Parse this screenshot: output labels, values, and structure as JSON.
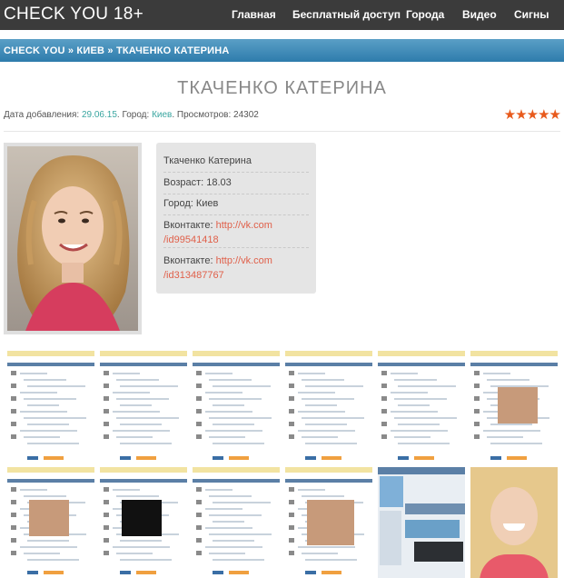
{
  "header": {
    "logo": "CHECK YOU 18+",
    "nav": [
      "Главная",
      "Бесплатный доступ",
      "Города",
      "Видео",
      "Сигны"
    ]
  },
  "breadcrumb": "CHECK YOU » КИЕВ » ТКАЧЕНКО КАТЕРИНА",
  "profile": {
    "title": "ТКАЧЕНКО КАТЕРИНА",
    "meta_added_label": "Дата добавления:",
    "meta_added_value": "29.06.15",
    "meta_city_label": "Город:",
    "meta_city_value": "Киев",
    "meta_views_label": "Просмотров:",
    "meta_views_value": "24302",
    "rating_stars": 5,
    "name": "Ткаченко Катерина",
    "age": "Возраст: 18.03",
    "city": "Город: Киев",
    "vk_label": "Вконтакте:",
    "vk1_a": "http://vk.com",
    "vk1_b": "/id99541418",
    "vk2_a": "http://vk.com",
    "vk2_b": "/id313487767"
  },
  "colors": {
    "topbar": "#3b3b3b",
    "breadcrumb": "#3b85b4",
    "accent_link": "#3aa6a0",
    "vk_link": "#e0604a",
    "stars": "#e85a1c"
  },
  "gallery": {
    "count": 12
  }
}
